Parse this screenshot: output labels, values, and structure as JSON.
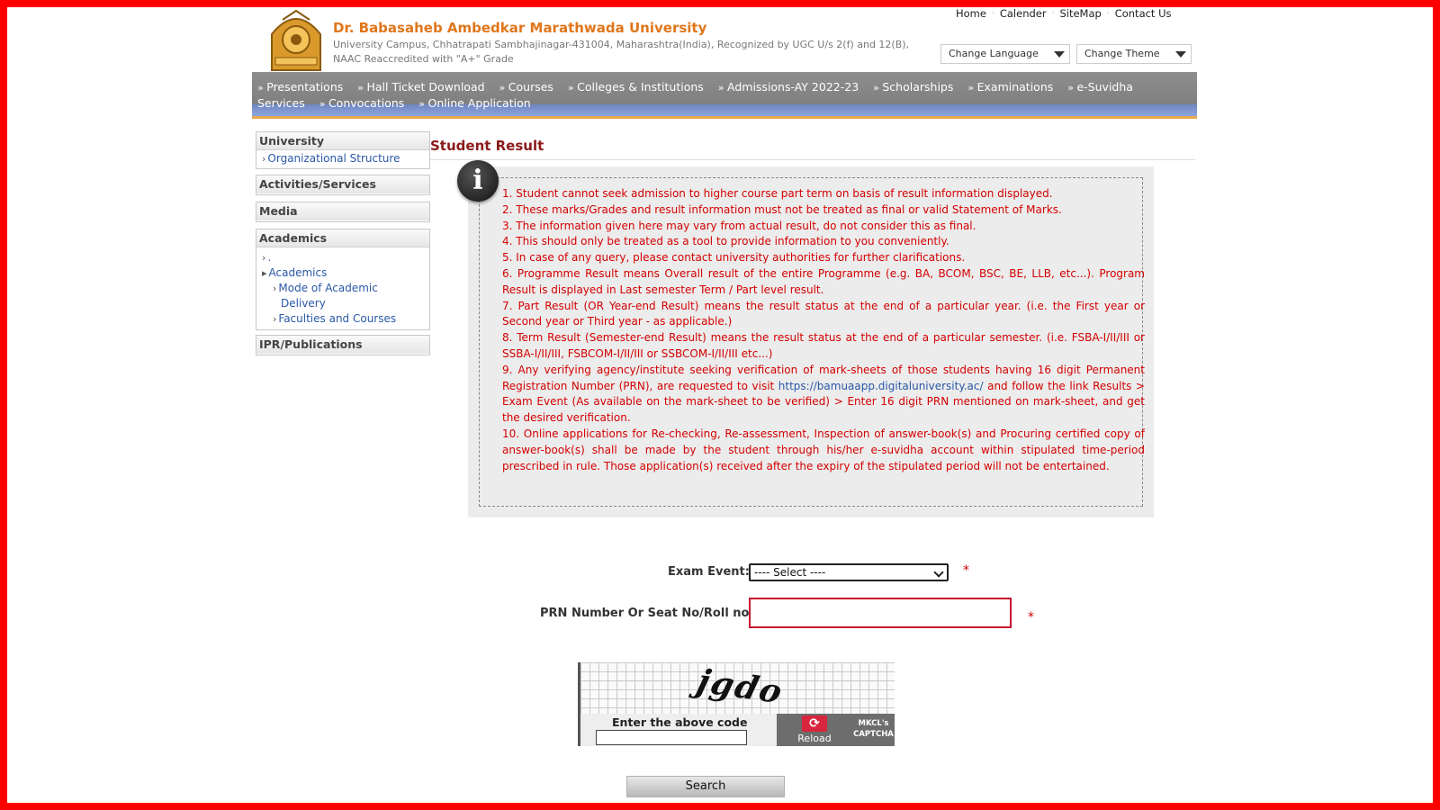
{
  "header": {
    "university_name": "Dr. Babasaheb Ambedkar Marathwada University",
    "subtitle_line1": "University Campus, Chhatrapati Sambhajinagar-431004, Maharashtra(India), Recognized by UGC U/s 2(f) and 12(B),",
    "subtitle_line2": "NAAC Reaccredited with \"A+\" Grade",
    "top_links": [
      "Home",
      "Calender",
      "SiteMap",
      "Contact Us"
    ],
    "change_language": "Change Language",
    "change_theme": "Change Theme"
  },
  "nav": {
    "items": [
      "Presentations",
      "Hall Ticket Download",
      "Courses",
      "Colleges & Institutions",
      "Admissions-AY 2022-23",
      "Scholarships",
      "Examinations",
      "e-Suvidha",
      "Services",
      "Convocations",
      "Online Application"
    ]
  },
  "sidebar": {
    "university": {
      "title": "University",
      "links": [
        "Organizational Structure"
      ]
    },
    "activities": {
      "title": "Activities/Services"
    },
    "media": {
      "title": "Media"
    },
    "academics": {
      "title": "Academics",
      "links": [
        ".",
        "Academics",
        "Mode of Academic",
        "Delivery",
        "Faculties and Courses"
      ]
    },
    "ipr": {
      "title": "IPR/Publications"
    }
  },
  "main": {
    "title": "Student Result",
    "info_icon": "info-icon",
    "notes": [
      "1. Student cannot seek admission to higher course part term on basis of result information displayed.",
      "2. These marks/Grades and result information must not be treated as final or valid Statement of Marks.",
      "3. The information given here may vary from actual result, do not consider this as final.",
      "4. This should only be treated as a tool to provide information to you conveniently.",
      "5. In case of any query, please contact university authorities for further clarifications.",
      "6. Programme Result means Overall result of the entire Programme (e.g. BA, BCOM, BSC, BE, LLB, etc...). Program Result is displayed in Last semester Term / Part level result.",
      "7. Part Result (OR Year-end Result) means the result status at the end of a particular year. (i.e. the First year or Second year or Third year - as applicable.)",
      "8. Term Result (Semester-end Result) means the result status at the end of a particular semester. (i.e. FSBA-I/II/III or SSBA-I/II/III, FSBCOM-I/II/III or SSBCOM-I/II/III etc...)"
    ],
    "note9_pre": "9. Any verifying agency/institute seeking verification of mark-sheets of those students having 16 digit Permanent Registration Number (PRN), are requested to visit",
    "note9_link": "https://bamuaapp.digitaluniversity.ac/",
    "note9_post": "and follow the link Results > Exam Event (As available on the mark-sheet to be verified) > Enter 16 digit PRN mentioned on mark-sheet, and get the desired verification.",
    "note10": "10. Online applications for Re-checking, Re-assessment, Inspection of answer-book(s) and Procuring certified copy of answer-book(s) shall be made by the student through his/her e-suvidha account within stipulated time-period prescribed in rule. Those application(s) received after the expiry of the stipulated period will not be entertained."
  },
  "form": {
    "exam_event_label": "Exam Event:",
    "exam_event_value": "---- Select ----",
    "prn_label": "PRN Number Or Seat No/Roll no:",
    "prn_value": "",
    "required_mark": "*",
    "captcha_text": "jgdo",
    "captcha_label": "Enter the above code",
    "captcha_value": "",
    "reload_label": "Reload",
    "captcha_brand_1": "MKCL's",
    "captcha_brand_2": "CAPTCHA",
    "search_label": "Search"
  },
  "colors": {
    "frame": "#ff0000",
    "university_name": "#e0761a",
    "page_title": "#8b1a1a",
    "notes_text": "#d40000",
    "link": "#2a58a8"
  }
}
